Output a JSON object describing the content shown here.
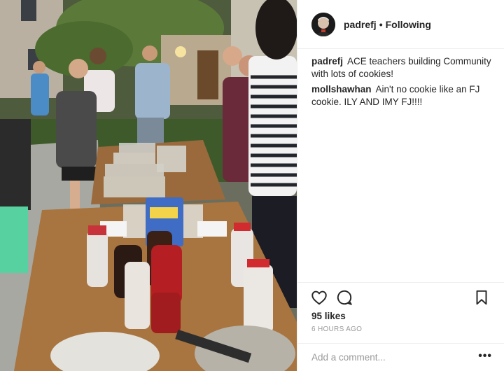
{
  "post": {
    "username": "padrefj",
    "separator": "•",
    "follow_status": "Following",
    "avatar_icon": "profile-photo",
    "photo_icon": "post-photo"
  },
  "comments": [
    {
      "user": "padrefj",
      "text": "ACE teachers building Community with lots of cookies!"
    },
    {
      "user": "mollshawhan",
      "text": "Ain't no cookie like an FJ cookie. ILY AND IMY FJ!!!!"
    }
  ],
  "actions": {
    "like_icon": "heart-icon",
    "comment_icon": "comment-icon",
    "save_icon": "bookmark-icon",
    "likes_text": "95 likes",
    "time_ago": "6 HOURS AGO"
  },
  "add_comment": {
    "placeholder": "Add a comment...",
    "more_label": "•••"
  },
  "colors": {
    "text": "#262626",
    "muted": "#999999",
    "divider": "#efefef"
  }
}
